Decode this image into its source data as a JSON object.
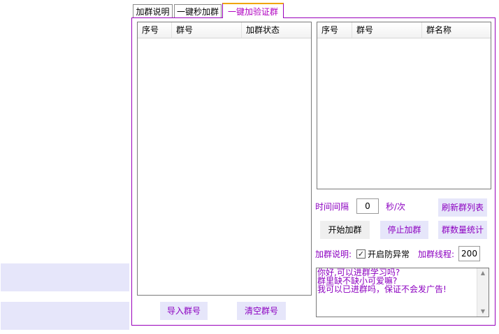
{
  "tabs": [
    {
      "label": "加群说明"
    },
    {
      "label": "一键秒加群"
    },
    {
      "label": "一键加验证群"
    }
  ],
  "left_list": {
    "columns": [
      "序号",
      "群号",
      "加群状态"
    ]
  },
  "right_list": {
    "columns": [
      "序号",
      "群号",
      "群名称"
    ]
  },
  "interval": {
    "label": "时间间隔",
    "value": "0",
    "unit": "秒/次"
  },
  "buttons": {
    "refresh": "刷新群列表",
    "start": "开始加群",
    "stop": "停止加群",
    "stats": "群数量统计",
    "import": "导入群号",
    "clear": "清空群号"
  },
  "options": {
    "note_label": "加群说明:",
    "anti_abnormal_label": "开启防异常",
    "anti_abnormal_checked": true,
    "threads_label": "加群线程:",
    "threads_value": "200"
  },
  "message": {
    "lines": [
      "你好,可以进群学习吗?",
      "群里缺不缺小可爱嘛?",
      "我可以已进群吗，保证不会发广告!"
    ]
  },
  "colors": {
    "accent": "#8c00c0",
    "frame_border": "#9900bb",
    "active_tab_top": "#f0a500",
    "button_bg": "#e6e6fa"
  }
}
